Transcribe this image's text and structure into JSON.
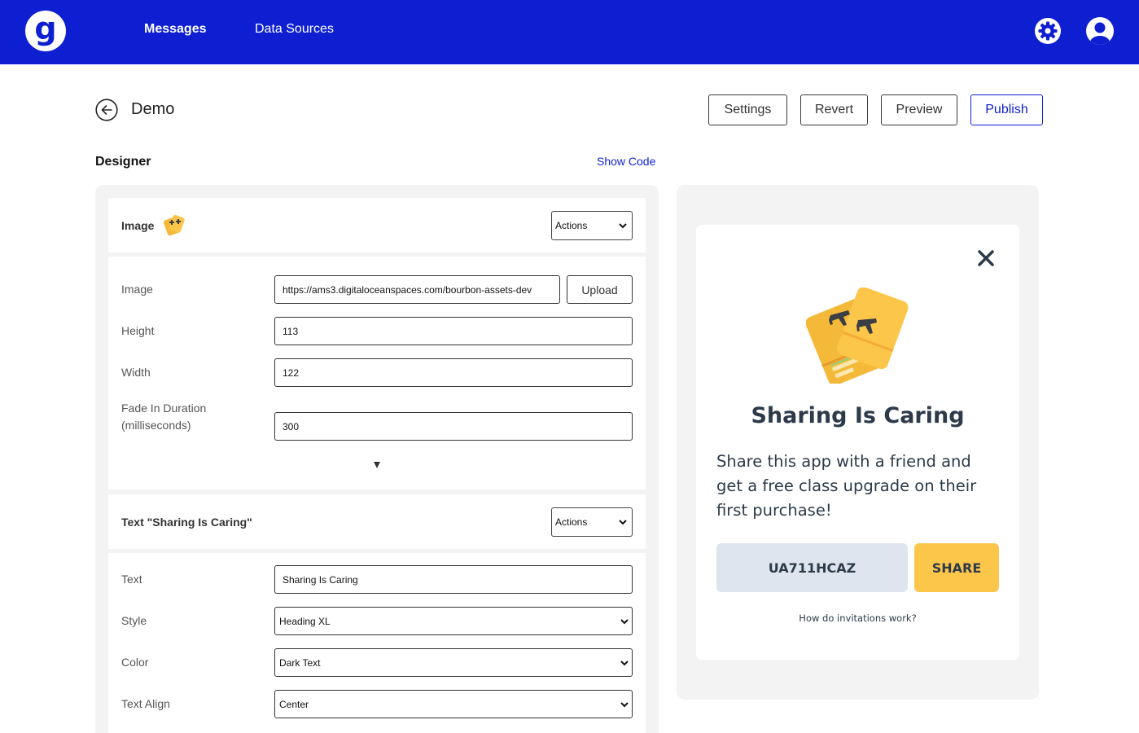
{
  "nav": {
    "logo_letter": "g",
    "messages": "Messages",
    "data_sources": "Data Sources",
    "brand_color": "#0e1fd2"
  },
  "header": {
    "title": "Demo",
    "settings": "Settings",
    "revert": "Revert",
    "preview": "Preview",
    "publish": "Publish"
  },
  "designer": {
    "label": "Designer",
    "show_code": "Show Code",
    "image_block": {
      "title": "Image",
      "actions": "Actions",
      "image_label": "Image",
      "image_url": "https://ams3.digitaloceanspaces.com/bourbon-assets-dev",
      "upload": "Upload",
      "height_label": "Height",
      "height": "113",
      "width_label": "Width",
      "width": "122",
      "fade_label_1": "Fade In Duration",
      "fade_label_2": "(milliseconds)",
      "fade": "300"
    },
    "text_block": {
      "title": "Text \"Sharing Is Caring\"",
      "actions": "Actions",
      "text_label": "Text",
      "text": "Sharing Is Caring",
      "style_label": "Style",
      "style": "Heading XL",
      "color_label": "Color",
      "color": "Dark Text",
      "align_label": "Text Align",
      "align": "Center"
    }
  },
  "preview": {
    "title": "Sharing Is Caring",
    "body": "Share this app with a friend and get a free class upgrade on their first purchase!",
    "code": "UA711HCAZ",
    "share": "SHARE",
    "how": "How do invitations work?",
    "accent": "#fcc64a"
  }
}
